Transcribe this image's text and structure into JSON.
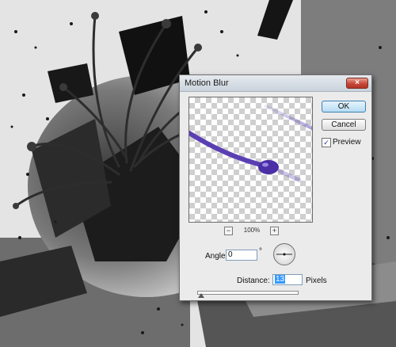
{
  "dialog": {
    "title": "Motion Blur",
    "close_glyph": "×",
    "ok_label": "OK",
    "cancel_label": "Cancel",
    "preview_label": "Preview",
    "preview_checked": true,
    "zoom": {
      "minus": "−",
      "value": "100%",
      "plus": "+"
    },
    "angle": {
      "label": "Angle:",
      "value": "0",
      "unit": "°"
    },
    "distance": {
      "label": "Distance:",
      "value": "13",
      "unit": "Pixels"
    }
  },
  "icons": [
    "close-icon",
    "check-icon",
    "zoom-out-icon",
    "zoom-in-icon",
    "angle-dial-icon"
  ],
  "colors": {
    "accent": "#3399ff",
    "blur_stroke": "#5a3fb3"
  }
}
